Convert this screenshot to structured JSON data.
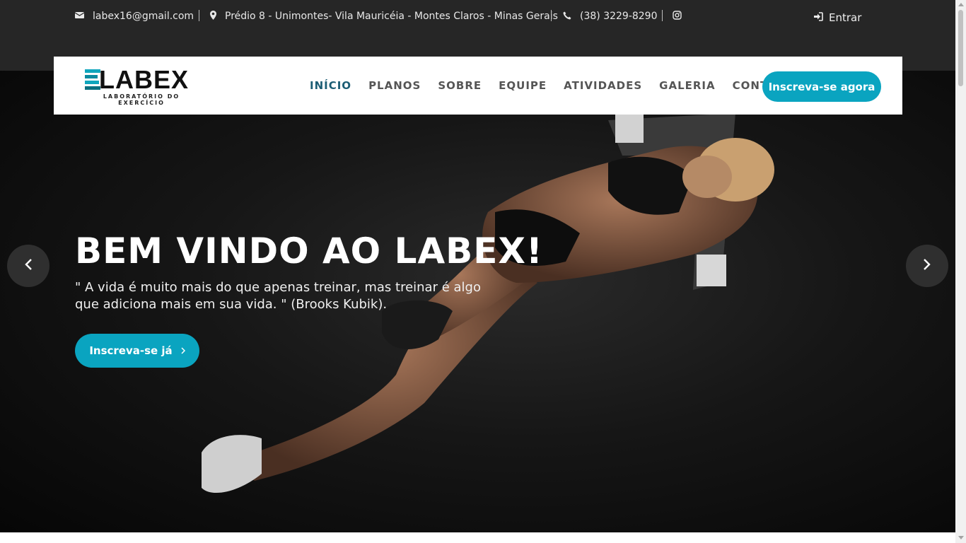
{
  "topbar": {
    "email": "labex16@gmail.com",
    "address": "Prédio 8 - Unimontes- Vila Mauricéia - Montes Claros - Minas Gerais",
    "phone": "(38) 3229-8290",
    "social_icon": "instagram-icon",
    "login_label": "Entrar"
  },
  "nav": {
    "logo_text": "LABEX",
    "logo_subtitle": "LABORATÓRIO DO EXERCÍCIO",
    "items": [
      {
        "label": "INÍCIO",
        "active": true
      },
      {
        "label": "PLANOS"
      },
      {
        "label": "SOBRE"
      },
      {
        "label": "EQUIPE"
      },
      {
        "label": "ATIVIDADES"
      },
      {
        "label": "GALERIA"
      },
      {
        "label": "CONTATO"
      }
    ],
    "cta_label": "Inscreva-se agora"
  },
  "hero": {
    "title": "BEM VINDO AO LABEX!",
    "quote": "\" A vida é muito mais do que apenas treinar, mas treinar é algo que adiciona mais em sua vida. \" (Brooks Kubik).",
    "cta_label": "Inscreva-se já",
    "prev_icon": "chevron-left-icon",
    "next_icon": "chevron-right-icon"
  },
  "colors": {
    "accent": "#0aa4c0",
    "topbar_bg": "#262626",
    "nav_active": "#1c5d74"
  }
}
